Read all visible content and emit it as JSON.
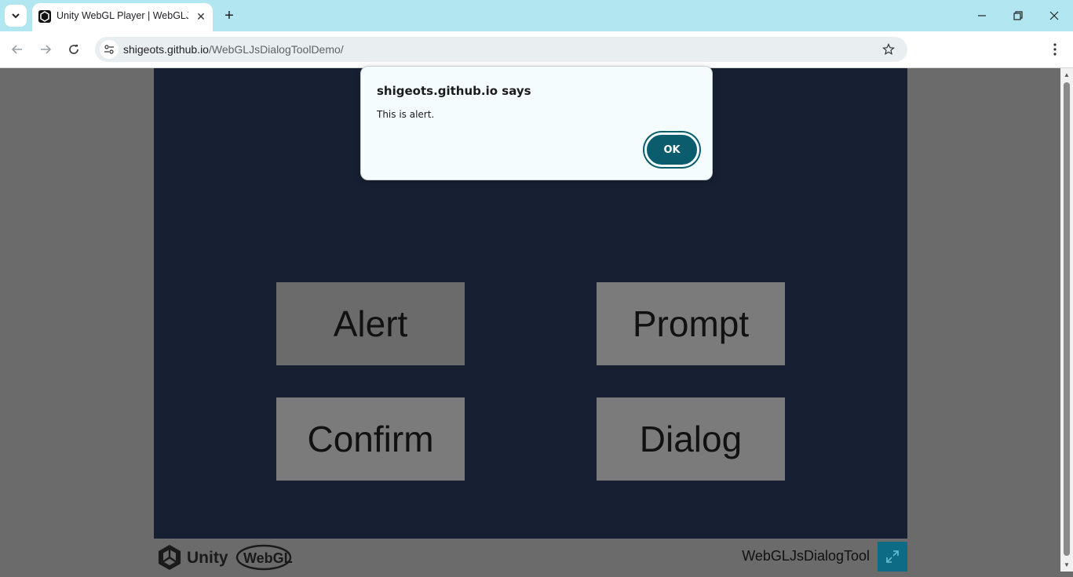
{
  "browser": {
    "tab_title": "Unity WebGL Player | WebGLJsD",
    "url_host": "shigeots.github.io",
    "url_path": "/WebGLJsDialogToolDemo/"
  },
  "unity_buttons": {
    "alert": "Alert",
    "prompt": "Prompt",
    "confirm": "Confirm",
    "dialog": "Dialog"
  },
  "footer": {
    "logo_unity": "Unity",
    "logo_webgl": "WebGL",
    "title": "WebGLJsDialogTool"
  },
  "alert_dialog": {
    "title": "shigeots.github.io says",
    "message": "This is alert.",
    "ok_label": "OK"
  },
  "colors": {
    "tabstrip": "#b2e7f1",
    "canvas": "#172033",
    "ok_button": "#0b5d6e",
    "fullscreen_button": "#0d6b86"
  }
}
